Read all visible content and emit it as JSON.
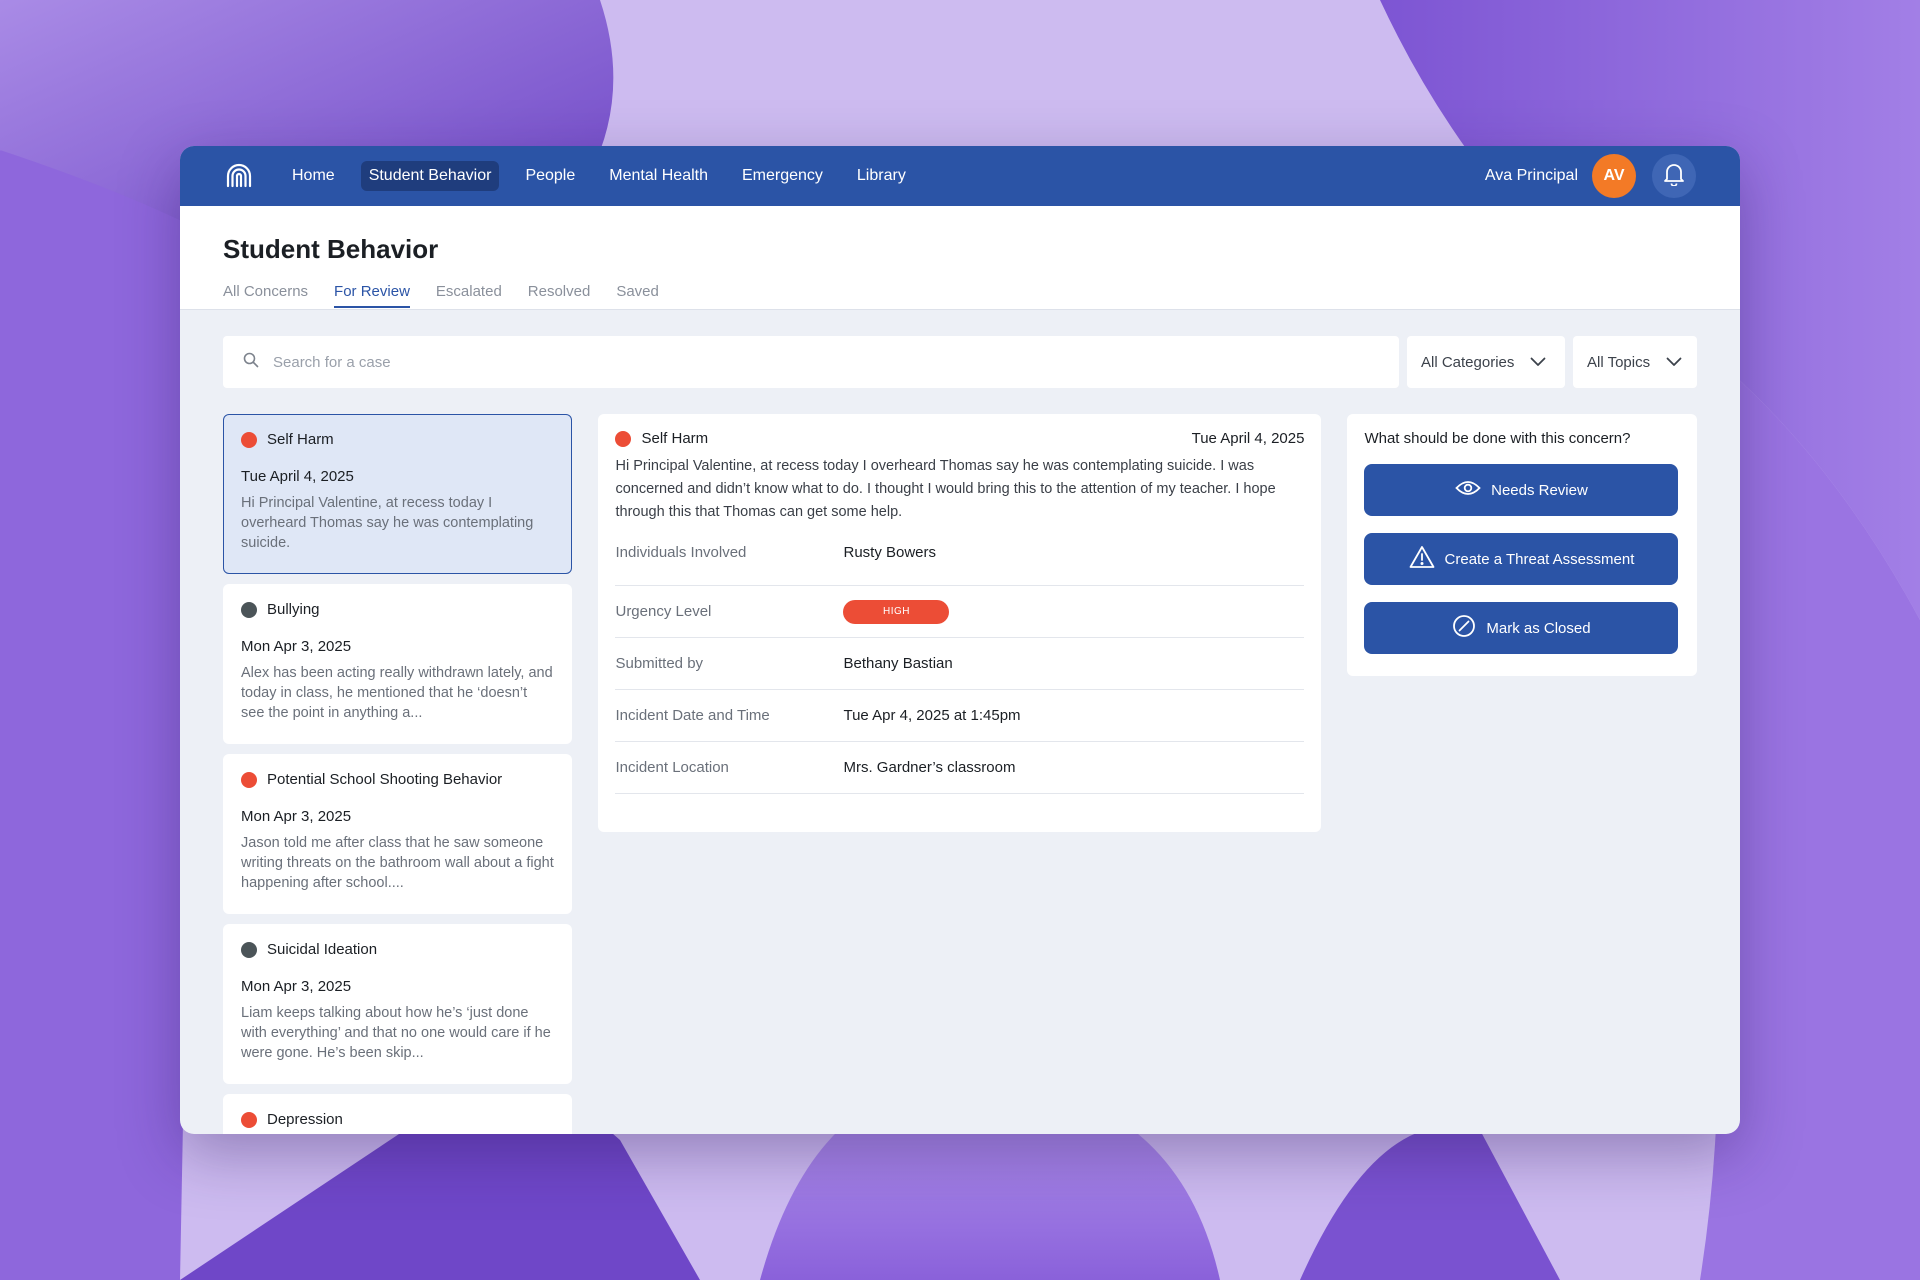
{
  "nav": {
    "items": [
      {
        "label": "Home"
      },
      {
        "label": "Student Behavior",
        "active": true
      },
      {
        "label": "People"
      },
      {
        "label": "Mental Health"
      },
      {
        "label": "Emergency"
      },
      {
        "label": "Library"
      }
    ],
    "user_name": "Ava Principal",
    "avatar_initials": "AV"
  },
  "page": {
    "title": "Student Behavior",
    "tabs": [
      {
        "label": "All Concerns"
      },
      {
        "label": "For Review",
        "active": true
      },
      {
        "label": "Escalated"
      },
      {
        "label": "Resolved"
      },
      {
        "label": "Saved"
      }
    ]
  },
  "filters": {
    "search_placeholder": "Search for a case",
    "categories": "All Categories",
    "topics": "All Topics"
  },
  "cases": [
    {
      "title": "Self Harm",
      "date": "Tue April 4, 2025",
      "snippet": "Hi Principal Valentine, at recess today I overheard Thomas say he was contemplating suicide.",
      "status_color": "#ec4d36"
    },
    {
      "title": "Bullying",
      "date": "Mon Apr 3, 2025",
      "snippet": "Alex has been acting really withdrawn lately, and today in class, he mentioned that he ‘doesn’t see the point in anything a...",
      "status_color": "#4b5458"
    },
    {
      "title": "Potential School Shooting Behavior",
      "date": "Mon Apr 3, 2025",
      "snippet": "Jason told me after class that he saw someone writing threats on the bathroom wall about a fight happening after school....",
      "status_color": "#ec4d36"
    },
    {
      "title": "Suicidal Ideation",
      "date": "Mon Apr 3, 2025",
      "snippet": "Liam keeps talking about how he’s ‘just done with everything’ and that no one would care if he were gone. He’s been skip...",
      "status_color": "#4b5458"
    },
    {
      "title": "Depression",
      "date": "",
      "snippet": "",
      "status_color": "#ec4d36"
    }
  ],
  "detail": {
    "title": "Self Harm",
    "date": "Tue April 4, 2025",
    "status_color": "#ec4d36",
    "body": "Hi Principal Valentine, at recess today I overheard Thomas say he was contemplating suicide. I was concerned and didn’t know what to do. I thought I would bring this to the attention of my teacher. I hope through this that Thomas can get some help.",
    "fields": {
      "individuals_label": "Individuals Involved",
      "individuals_value": "Rusty Bowers",
      "urgency_label": "Urgency Level",
      "urgency_value": "HIGH",
      "submitted_label": "Submitted by",
      "submitted_value": "Bethany Bastian",
      "datetime_label": "Incident Date and Time",
      "datetime_value": "Tue Apr 4, 2025 at 1:45pm",
      "location_label": "Incident Location",
      "location_value": "Mrs. Gardner’s classroom"
    }
  },
  "actions": {
    "question": "What should be done with this concern?",
    "needs_review": "Needs Review",
    "threat_assessment": "Create a Threat Assessment",
    "mark_closed": "Mark as Closed"
  },
  "colors": {
    "primary": "#2b54a6",
    "avatar": "#f37a26",
    "danger": "#ec4d36",
    "neutral_dot": "#4b5458",
    "background": "#edf0f6"
  },
  "icons": {
    "logo": "fingerprint-logo-icon",
    "bell": "bell-icon",
    "search": "search-icon",
    "chevron": "chevron-down-icon",
    "eye": "eye-icon",
    "warning": "warning-triangle-icon",
    "closed": "slashed-circle-icon"
  }
}
